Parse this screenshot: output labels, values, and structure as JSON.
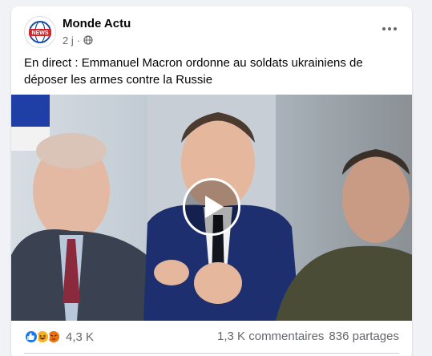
{
  "post": {
    "page_name": "Monde Actu",
    "avatar_logo_text": "NEWS",
    "time": "2 j",
    "audience_icon": "globe-icon",
    "more_icon": "more-options-icon",
    "text": "En direct : Emmanuel Macron ordonne au soldats ukrainiens de déposer les armes contre la Russie",
    "media": {
      "type": "video",
      "play_icon": "play-icon"
    },
    "reactions": {
      "icons": [
        "like-icon",
        "haha-icon",
        "angry-icon"
      ],
      "count": "4,3 K"
    },
    "comments": "1,3 K commentaires",
    "shares": "836 partages"
  },
  "colors": {
    "background": "#f0f2f5",
    "card": "#ffffff",
    "secondary_text": "#65676b",
    "like_blue": "#1877f2",
    "haha_yellow": "#f7b125",
    "angry_orange": "#e9710f"
  }
}
